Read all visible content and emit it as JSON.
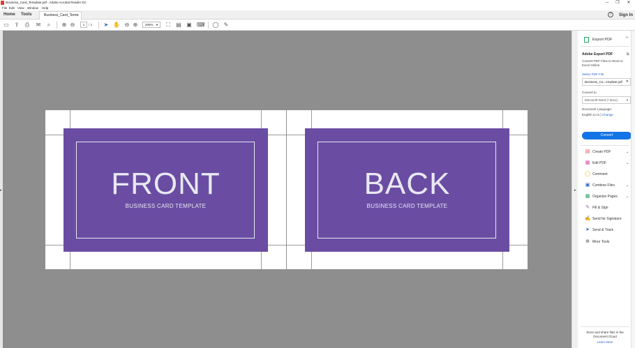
{
  "window": {
    "title": "Business_Card_Template.pdf - Adobe Acrobat Reader DC",
    "minimize": "─",
    "restore": "❐",
    "close": "✕"
  },
  "menu": [
    "File",
    "Edit",
    "View",
    "Window",
    "Help"
  ],
  "tabs": {
    "home": "Home",
    "tools": "Tools",
    "document": "Business_Card_Tem...",
    "help": "?",
    "sign_in": "Sign In"
  },
  "toolbar": {
    "page_current": "1",
    "page_total": "/ 2",
    "zoom": "200%"
  },
  "document": {
    "front": {
      "heading": "FRONT",
      "subtitle": "BUSINESS CARD TEMPLATE"
    },
    "back": {
      "heading": "BACK",
      "subtitle": "BUSINESS CARD TEMPLATE"
    },
    "card_color": "#6a4da3"
  },
  "panel": {
    "header": "Export PDF",
    "section_title": "Adobe Export PDF",
    "description": "Convert PDF Files to Word or Excel Online",
    "select_pdf": "Select PDF File",
    "file_name": "Business_Ca...emplate.pdf",
    "convert_to_label": "Convert to",
    "convert_to_value": "Microsoft Word (*.docx)",
    "doc_language_label": "Document Language:",
    "doc_language_value": "English (U.S.)",
    "change": "Change",
    "convert_button": "Convert",
    "accent": "#1473e6",
    "tools": [
      {
        "label": "Create PDF",
        "icon": "create-pdf-icon"
      },
      {
        "label": "Edit PDF",
        "icon": "edit-pdf-icon"
      },
      {
        "label": "Comment",
        "icon": "comment-icon"
      },
      {
        "label": "Combine Files",
        "icon": "combine-files-icon"
      },
      {
        "label": "Organize Pages",
        "icon": "organize-pages-icon"
      },
      {
        "label": "Fill & Sign",
        "icon": "fill-sign-icon"
      },
      {
        "label": "Send for Signature",
        "icon": "send-signature-icon"
      },
      {
        "label": "Send & Track",
        "icon": "send-track-icon"
      },
      {
        "label": "More Tools",
        "icon": "more-tools-icon"
      }
    ],
    "promo": "Store and share files in the Document Cloud",
    "learn_more": "Learn More"
  }
}
